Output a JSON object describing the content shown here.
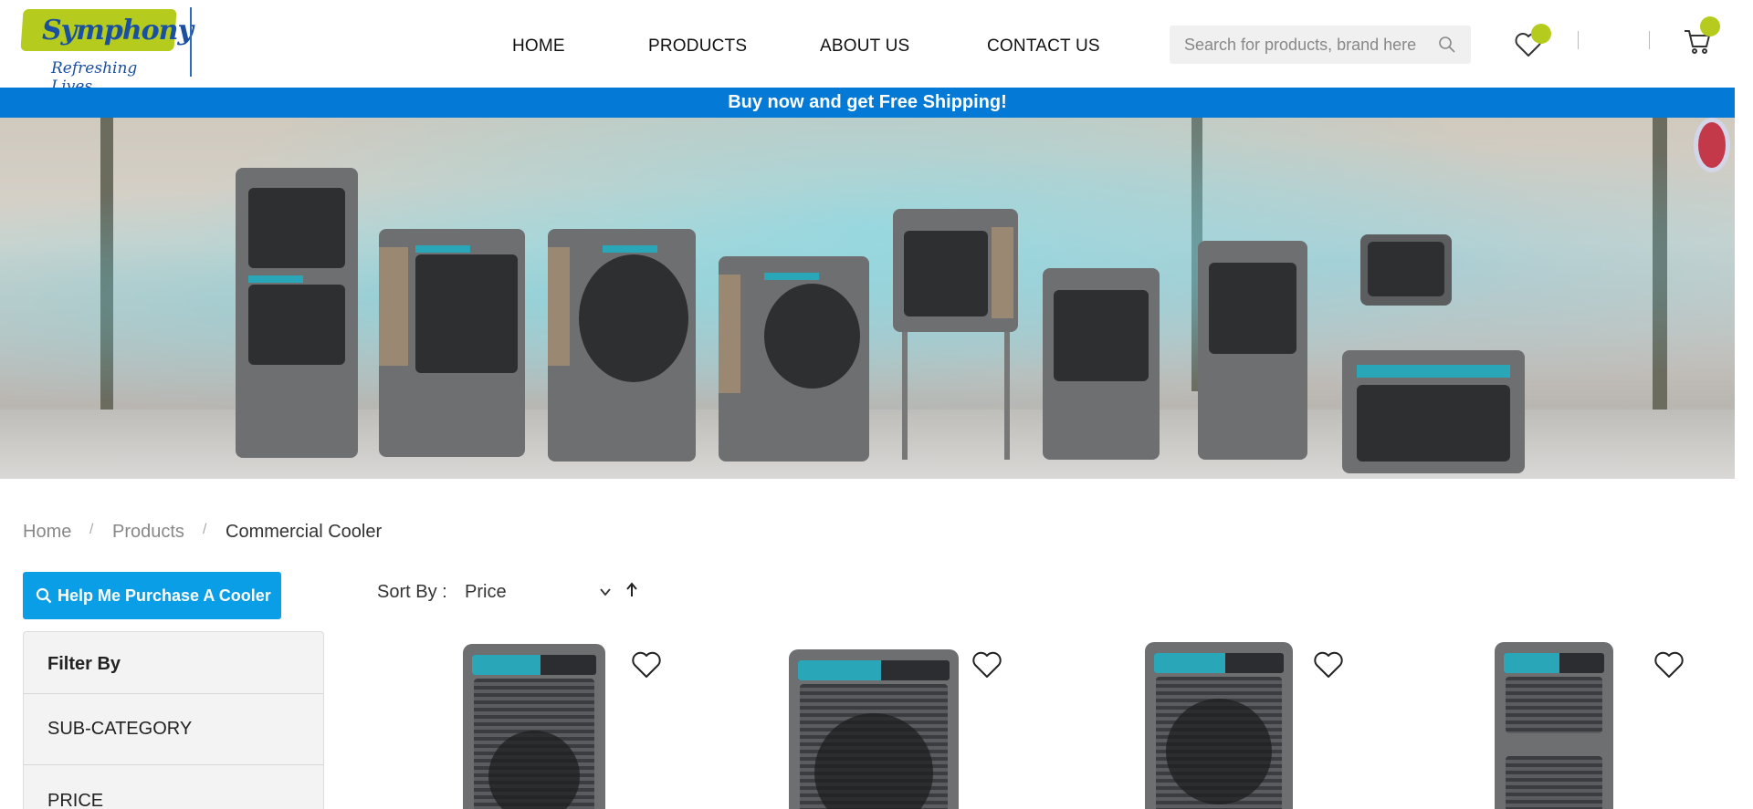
{
  "brand": {
    "name": "Symphony",
    "tagline": "Refreshing Lives"
  },
  "nav": {
    "home": "HOME",
    "products": "PRODUCTS",
    "about": "ABOUT US",
    "contact": "CONTACT US"
  },
  "search": {
    "placeholder": "Search for products, brand here"
  },
  "promo": {
    "text": "Buy now and get Free Shipping!"
  },
  "breadcrumb": {
    "home": "Home",
    "products": "Products",
    "current": "Commercial Cooler",
    "separator": "/"
  },
  "help_button": {
    "label": "Help Me Purchase A Cooler"
  },
  "filter": {
    "title": "Filter By",
    "sections": [
      "SUB-CATEGORY",
      "PRICE"
    ]
  },
  "sort": {
    "label": "Sort By :",
    "value": "Price"
  },
  "colors": {
    "brand_green": "#b5cc1f",
    "brand_blue": "#1b4fa0",
    "promo_blue": "#0579d6",
    "button_blue": "#0a9ee6"
  },
  "icons": {
    "search": "search-icon",
    "wishlist": "heart-icon",
    "cart": "cart-icon",
    "chevron": "chevron-down-icon",
    "sort_direction": "arrow-up-icon"
  }
}
